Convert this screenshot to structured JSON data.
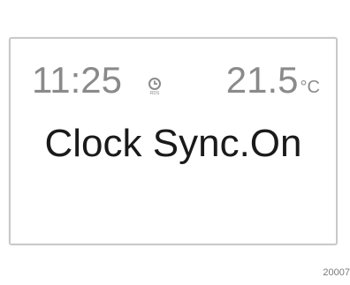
{
  "display": {
    "time": "11:25",
    "clock_icon_label": "RDS",
    "temperature_value": "21.5",
    "temperature_unit": "°C",
    "message": "Clock Sync.On"
  },
  "figure_id": "20007",
  "colors": {
    "status_text": "#8a8a8a",
    "message_text": "#1a1a1a",
    "bezel": "#c9c9c9"
  },
  "icons": [
    "rds-clock-icon"
  ]
}
